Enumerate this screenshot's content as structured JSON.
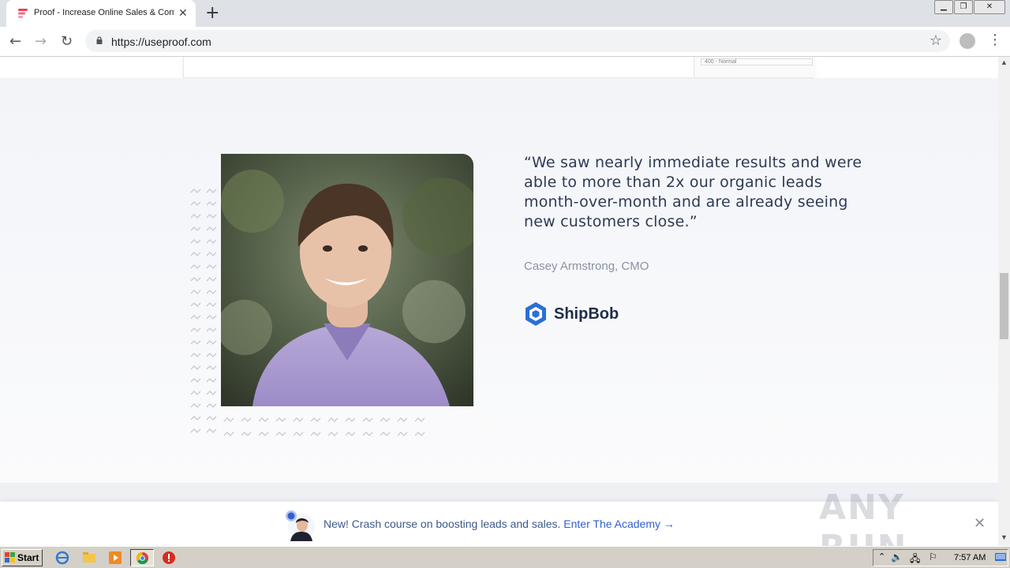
{
  "browser": {
    "tab_title": "Proof - Increase Online Sales & Conv",
    "url": "https://useproof.com"
  },
  "page": {
    "top_card": {
      "select_value": "400 - Normal"
    },
    "testimonial": {
      "quote": "“We saw nearly immediate results and were able to more than 2x our organic leads month-over-month and are already seeing new customers close.”",
      "author": "Casey Armstrong, CMO",
      "brand": "ShipBob"
    },
    "promo_bar": {
      "text": "New! Crash course on boosting leads and sales.",
      "link": "Enter The Academy →"
    },
    "watermark": "ANY RUN"
  },
  "taskbar": {
    "start_label": "Start",
    "clock": "7:57 AM"
  },
  "colors": {
    "accent_blue": "#2f5fd0",
    "brand_blue": "#2b6fd6",
    "quote_text": "#2e3b55"
  }
}
